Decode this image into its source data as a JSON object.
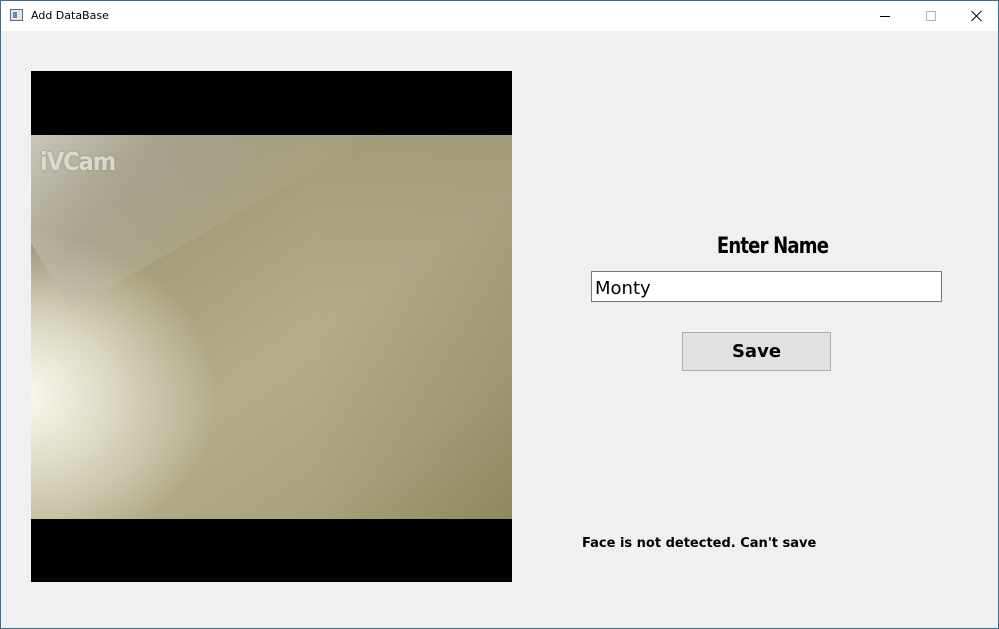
{
  "window": {
    "title": "Add DataBase",
    "controls": {
      "minimize": "minimize-icon",
      "maximize": "maximize-icon",
      "close": "close-icon"
    }
  },
  "camera": {
    "watermark": "iVCam"
  },
  "form": {
    "label": "Enter Name",
    "name_value": "Monty",
    "save_label": "Save"
  },
  "status": {
    "message": "Face is not detected. Can't save"
  },
  "colors": {
    "window_background": "#f0f0f0",
    "titlebar_background": "#ffffff",
    "button_background": "#e1e1e1",
    "camera_letterbox": "#000000"
  }
}
